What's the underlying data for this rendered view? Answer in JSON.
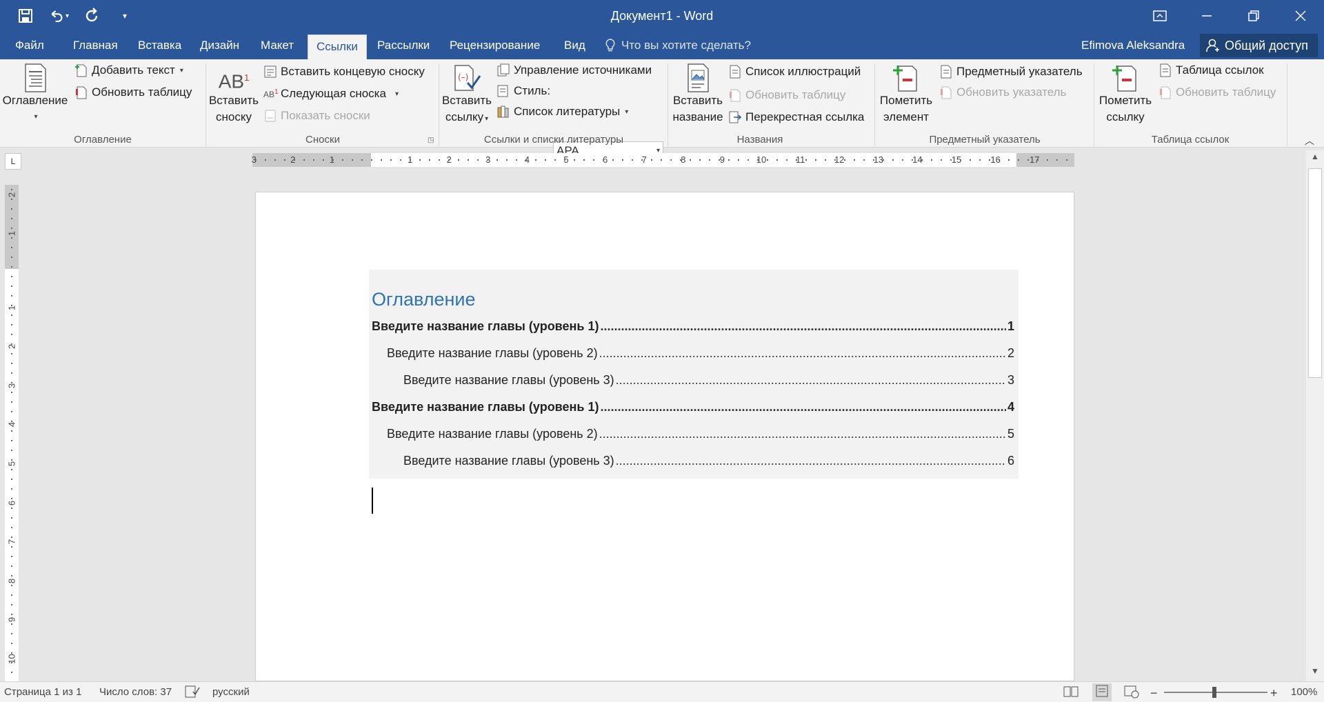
{
  "window": {
    "title": "Документ1 - Word",
    "qat_customize": "▾"
  },
  "tabs": {
    "items": [
      {
        "label": "Файл"
      },
      {
        "label": "Главная"
      },
      {
        "label": "Вставка"
      },
      {
        "label": "Дизайн"
      },
      {
        "label": "Макет"
      },
      {
        "label": "Ссылки"
      },
      {
        "label": "Рассылки"
      },
      {
        "label": "Рецензирование"
      },
      {
        "label": "Вид"
      }
    ],
    "active": "Ссылки",
    "tell_me": "Что вы хотите сделать?",
    "user": "Efimova Aleksandra",
    "share": "Общий доступ"
  },
  "ribbon": {
    "toc_group": {
      "label": "Оглавление",
      "toc_button_line1": "Оглавление",
      "add_text": "Добавить текст",
      "update_table": "Обновить таблицу"
    },
    "footnotes_group": {
      "label": "Сноски",
      "insert_footnote_line1": "Вставить",
      "insert_footnote_line2": "сноску",
      "insert_endnote": "Вставить концевую сноску",
      "next_footnote": "Следующая сноска",
      "show_notes": "Показать сноски"
    },
    "citations_group": {
      "label": "Ссылки и списки литературы",
      "insert_citation_line1": "Вставить",
      "insert_citation_line2": "ссылку",
      "manage_sources": "Управление источниками",
      "style_label": "Стиль:",
      "style_value": "APA",
      "bibliography": "Список литературы"
    },
    "captions_group": {
      "label": "Названия",
      "insert_caption_line1": "Вставить",
      "insert_caption_line2": "название",
      "insert_table_of_figures": "Список иллюстраций",
      "update_table": "Обновить таблицу",
      "cross_reference": "Перекрестная ссылка"
    },
    "index_group": {
      "label": "Предметный указатель",
      "mark_entry_line1": "Пометить",
      "mark_entry_line2": "элемент",
      "insert_index": "Предметный указатель",
      "update_index": "Обновить указатель"
    },
    "toa_group": {
      "label": "Таблица ссылок",
      "mark_citation_line1": "Пометить",
      "mark_citation_line2": "ссылку",
      "insert_toa": "Таблица ссылок",
      "update_table": "Обновить таблицу"
    }
  },
  "ruler": {
    "corner": "L",
    "h_numbers": [
      "3",
      "2",
      "1",
      "1",
      "2",
      "3",
      "4",
      "5",
      "6",
      "7",
      "8",
      "9",
      "10",
      "11",
      "12",
      "13",
      "14",
      "15",
      "16",
      "17"
    ],
    "v_numbers": [
      "2",
      "1",
      "1",
      "2",
      "3",
      "4",
      "5",
      "6",
      "7",
      "8",
      "9",
      "10"
    ]
  },
  "document": {
    "toc_title": "Оглавление",
    "entries": [
      {
        "text": "Введите название главы (уровень 1)",
        "page": "1",
        "level": 1
      },
      {
        "text": "Введите название главы (уровень 2)",
        "page": "2",
        "level": 2
      },
      {
        "text": "Введите название главы (уровень 3)",
        "page": "3",
        "level": 3
      },
      {
        "text": "Введите название главы (уровень 1)",
        "page": "4",
        "level": 1
      },
      {
        "text": "Введите название главы (уровень 2)",
        "page": "5",
        "level": 2
      },
      {
        "text": "Введите название главы (уровень 3)",
        "page": "6",
        "level": 3
      }
    ]
  },
  "status": {
    "page": "Страница 1 из 1",
    "words": "Число слов: 37",
    "language": "русский",
    "zoom": "100%",
    "zoom_minus": "−",
    "zoom_plus": "+"
  },
  "colors": {
    "title_bar": "#2b579a",
    "toc_heading": "#2e74b5",
    "toc_background": "#f2f2f2"
  }
}
